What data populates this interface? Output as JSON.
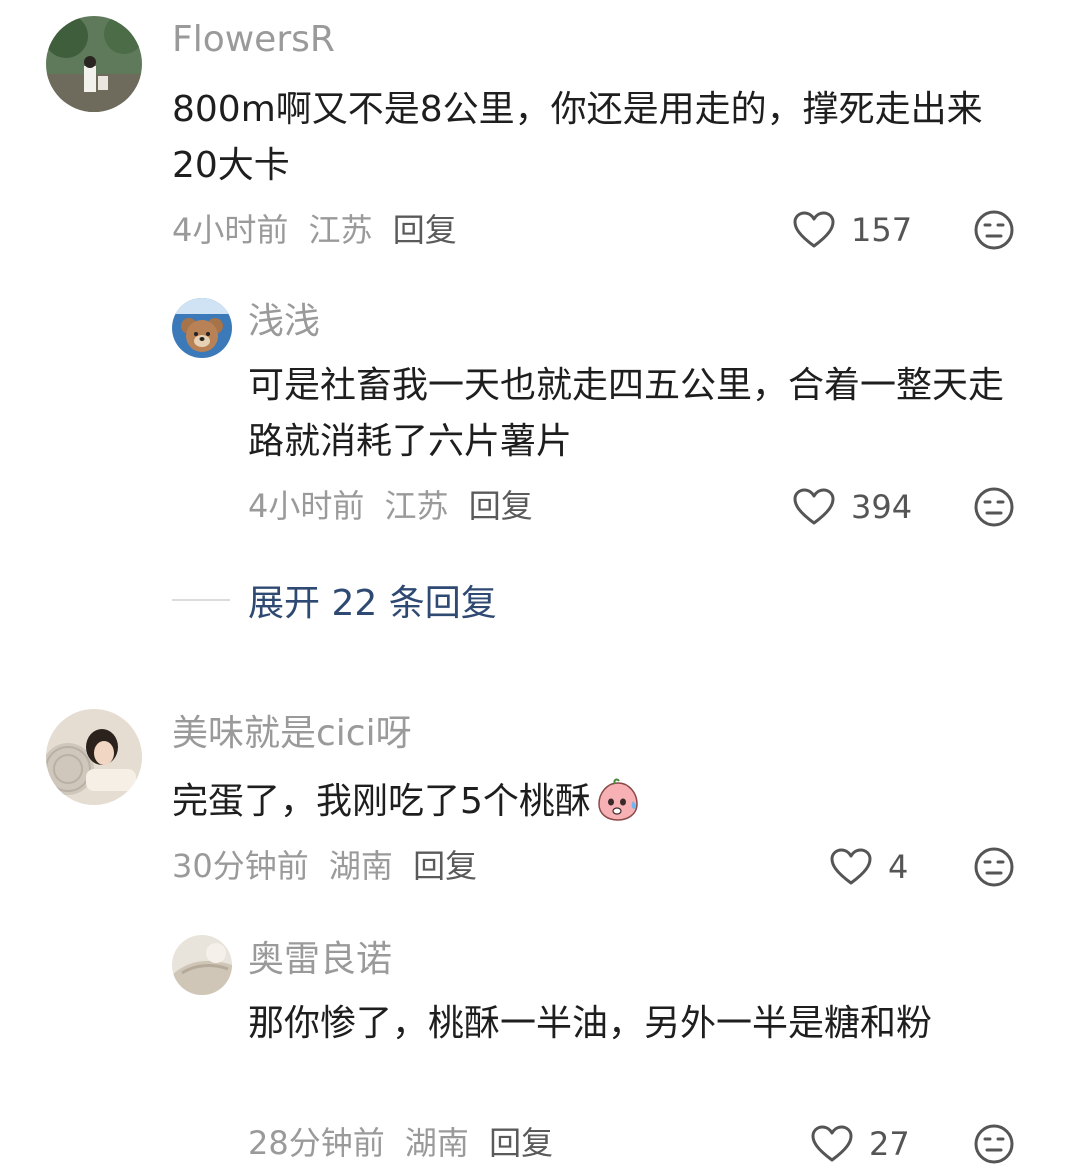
{
  "comments": [
    {
      "username": "FlowersR",
      "text": "800m啊又不是8公里，你还是用走的，撑死走出来20大卡",
      "time": "4小时前",
      "location": "江苏",
      "reply_label": "回复",
      "likes": "157"
    },
    {
      "username": "浅浅",
      "text": "可是社畜我一天也就走四五公里，合着一整天走路就消耗了六片薯片",
      "time": "4小时前",
      "location": "江苏",
      "reply_label": "回复",
      "likes": "394"
    },
    {
      "username": "美味就是cici呀",
      "text": "完蛋了，我刚吃了5个桃酥",
      "time": "30分钟前",
      "location": "湖南",
      "reply_label": "回复",
      "likes": "4"
    },
    {
      "username": "奥雷良诺",
      "text": "那你惨了，桃酥一半油，另外一半是糖和粉",
      "time": "28分钟前",
      "location": "湖南",
      "reply_label": "回复",
      "likes": "27"
    }
  ],
  "expand_replies": {
    "label": "展开 22 条回复"
  },
  "colors": {
    "accent": "#2f4a72",
    "muted": "#9a9a9a",
    "text": "#1e1e1e"
  },
  "icons": {
    "like": "heart-outline-icon",
    "dislike": "meh-face-icon",
    "inline_emoji": "sweat-peach-emoji"
  }
}
